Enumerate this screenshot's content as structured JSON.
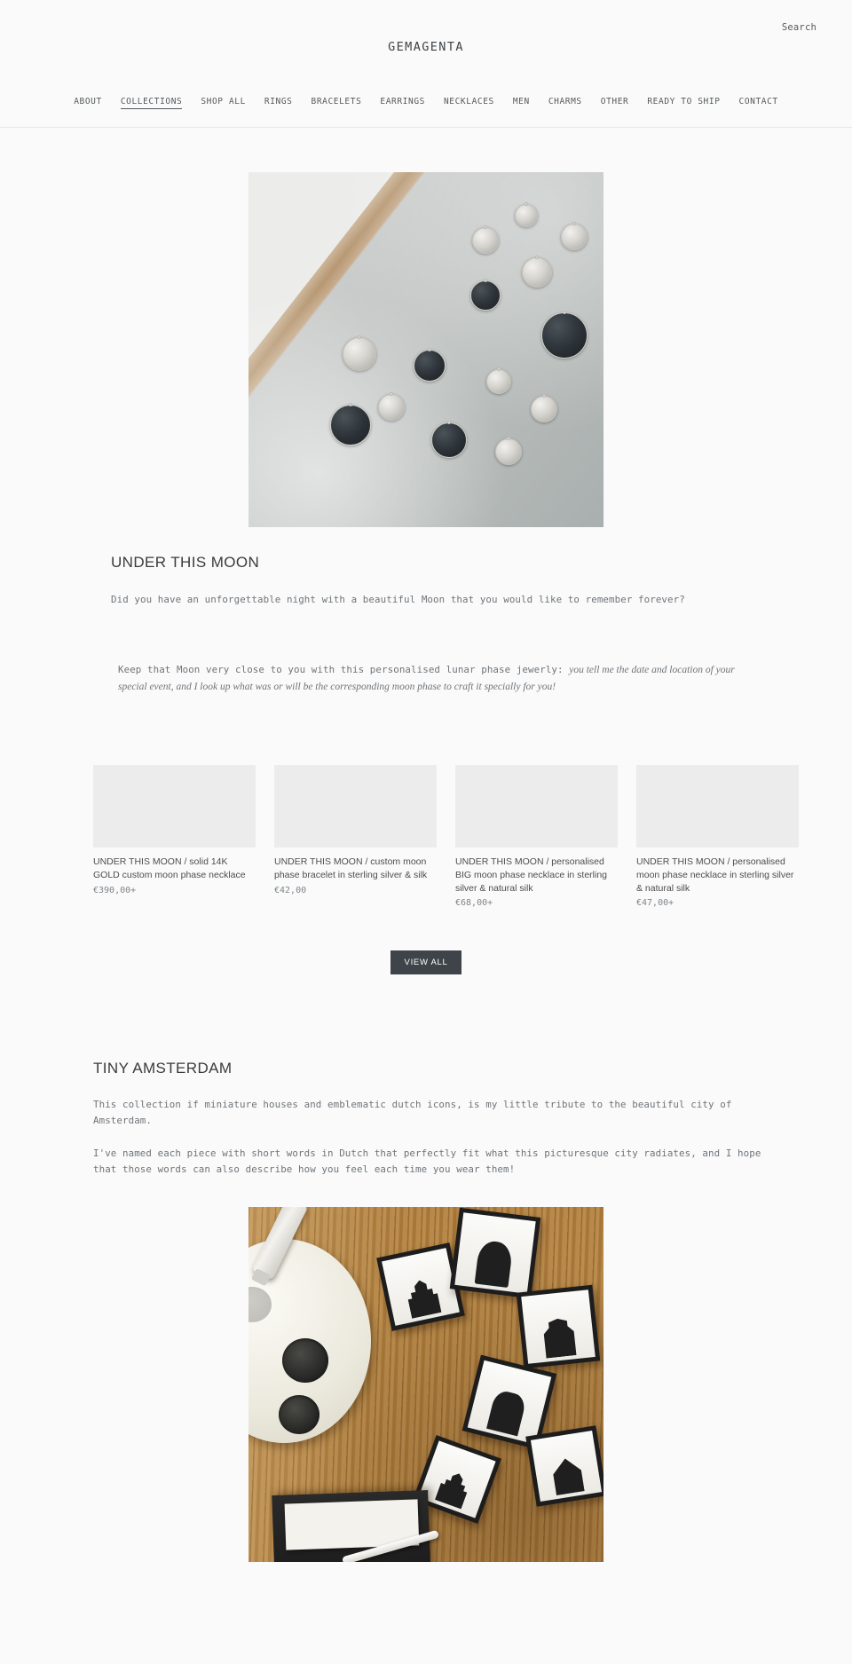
{
  "header": {
    "search_label": "Search",
    "brand": "GEMAGENTA",
    "nav": [
      {
        "label": "ABOUT",
        "active": false
      },
      {
        "label": "COLLECTIONS",
        "active": true
      },
      {
        "label": "SHOP ALL",
        "active": false
      },
      {
        "label": "RINGS",
        "active": false
      },
      {
        "label": "BRACELETS",
        "active": false
      },
      {
        "label": "EARRINGS",
        "active": false
      },
      {
        "label": "NECKLACES",
        "active": false
      },
      {
        "label": "MEN",
        "active": false
      },
      {
        "label": "CHARMS",
        "active": false
      },
      {
        "label": "OTHER",
        "active": false
      },
      {
        "label": "READY TO SHIP",
        "active": false
      },
      {
        "label": "CONTACT",
        "active": false
      }
    ]
  },
  "under_this_moon": {
    "title": "UNDER THIS MOON",
    "lead": "Did you have an unforgettable night with a beautiful Moon that you would like to remember forever?",
    "sub_mono": "Keep that Moon very close to you with this personalised lunar phase jewerly:",
    "sub_italic": "you tell me the date and location of your special event, and I look up what was or will be the corresponding moon phase to craft it specially for you!",
    "products": [
      {
        "title": "UNDER THIS MOON / solid 14K GOLD custom moon phase necklace",
        "price": "€390,00+"
      },
      {
        "title": "UNDER THIS MOON / custom moon phase bracelet in sterling silver & silk",
        "price": "€42,00"
      },
      {
        "title": "UNDER THIS MOON / personalised BIG moon phase necklace in sterling silver & natural silk",
        "price": "€68,00+"
      },
      {
        "title": "UNDER THIS MOON / personalised moon phase necklace in sterling silver & natural silk",
        "price": "€47,00+"
      }
    ],
    "view_all_label": "VIEW ALL"
  },
  "tiny_amsterdam": {
    "title": "TINY AMSTERDAM",
    "paragraph_1": "This collection if miniature houses and emblematic dutch icons, is my little tribute to the beautiful city of Amsterdam.",
    "paragraph_2": "I've named each piece with short words in Dutch that perfectly fit what this picturesque city radiates, and I hope that those words can also describe how you feel each time you wear them!"
  },
  "colors": {
    "page_background": "#fafafa",
    "text": "#4a4a4a",
    "muted_text": "#6f7479",
    "button_background": "#3e4449",
    "button_text": "#ffffff",
    "thumb_placeholder": "#ececec"
  }
}
